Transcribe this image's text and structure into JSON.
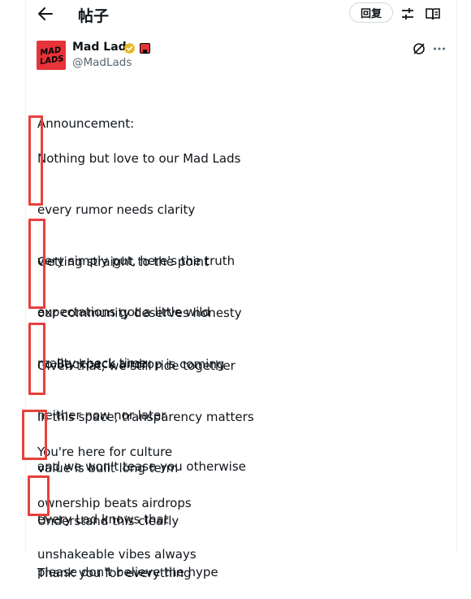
{
  "header": {
    "title": "帖子",
    "reply_label": "回复"
  },
  "author": {
    "name": "Mad Lads",
    "handle": "@MadLads",
    "logo_text_top": "MAD",
    "logo_text_bottom": "LADS"
  },
  "post": {
    "paragraphs": [
      [
        "Announcement:"
      ],
      [
        "Nothing but love to our Mad Lads",
        "every rumor needs clarity",
        "very simply put, here's the truth",
        "expectations got a little wild",
        "reality check time"
      ],
      [
        "Getting straight to the point",
        "our community deserves honesty",
        "no Backpack airdrop is coming",
        "neither now nor later",
        "and we won't tease you otherwise"
      ],
      [
        "Given that, we still ride together",
        "in this space, transparency matters",
        "value is built long term",
        "every Lad knows that"
      ],
      [
        "You're here for culture",
        "ownership beats airdrops",
        "unshakeable vibes always"
      ],
      [
        "Understand this clearly",
        "please don't believe the hype"
      ],
      [
        "Thank you for everything"
      ]
    ]
  },
  "colors": {
    "text": "#0f1419",
    "secondary": "#536471",
    "brand_red": "#e7333a",
    "highlight_red": "#e8403c",
    "verified_gold": "#e8b829"
  },
  "icons": [
    "back-arrow-icon",
    "sliders-icon",
    "reader-mode-icon",
    "verified-badge-icon",
    "affiliate-badge-icon",
    "grok-icon",
    "more-icon"
  ]
}
